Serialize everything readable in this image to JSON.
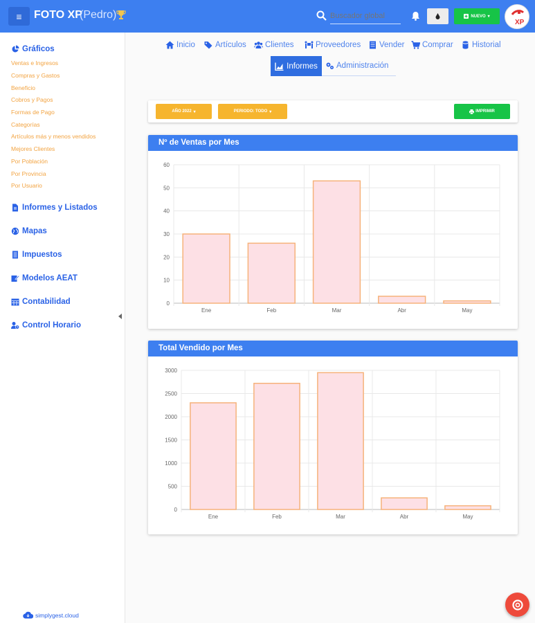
{
  "header": {
    "menu_icon": "hamburger-icon",
    "title": "FOTO XP",
    "user": "(Pedro)",
    "search_placeholder": "Buscador global",
    "new_button": "NUEVO",
    "colors": {
      "primary": "#3d7ff0",
      "success": "#17c447",
      "warning": "#f6b52e"
    }
  },
  "sidebar": {
    "sections": [
      {
        "label": "Gráficos",
        "icon": "pie-chart-icon"
      },
      {
        "label": "Informes y Listados",
        "icon": "file-icon"
      },
      {
        "label": "Mapas",
        "icon": "globe-icon"
      },
      {
        "label": "Impuestos",
        "icon": "document-icon"
      },
      {
        "label": "Modelos AEAT",
        "icon": "edit-icon"
      },
      {
        "label": "Contabilidad",
        "icon": "calendar-icon"
      },
      {
        "label": "Control Horario",
        "icon": "user-clock-icon"
      }
    ],
    "graficos_items": [
      "Ventas e Ingresos",
      "Compras y Gastos",
      "Beneficio",
      "Cobros y Pagos",
      "Formas de Pago",
      "Categorías",
      "Artículos más y menos vendidos",
      "Mejores Clientes",
      "Por Población",
      "Por Provincia",
      "Por Usuario"
    ],
    "footer": "simplygest.cloud"
  },
  "nav": {
    "tabs": [
      "Inicio",
      "Artículos",
      "Clientes",
      "Proveedores",
      "Vender",
      "Comprar",
      "Historial"
    ],
    "active": "Informes",
    "admin": "Administración"
  },
  "filters": {
    "year": "AÑO 2022",
    "period": "PERIODO: TODO",
    "print": "IMPRIMIR"
  },
  "chart_data": [
    {
      "type": "bar",
      "title": "Nº de Ventas por Mes",
      "categories": [
        "Ene",
        "Feb",
        "Mar",
        "Abr",
        "May"
      ],
      "values": [
        30,
        26,
        53,
        3,
        1
      ],
      "ylim": [
        0,
        60
      ],
      "yticks": [
        0,
        10,
        20,
        30,
        40,
        50,
        60
      ],
      "grid": true,
      "colors": {
        "fill": "#fde0e5",
        "stroke": "#f6b27a"
      }
    },
    {
      "type": "bar",
      "title": "Total Vendido por Mes",
      "categories": [
        "Ene",
        "Feb",
        "Mar",
        "Abr",
        "May"
      ],
      "values": [
        2300,
        2720,
        2950,
        250,
        80
      ],
      "ylim": [
        0,
        3000
      ],
      "yticks": [
        0,
        500,
        1000,
        1500,
        2000,
        2500,
        3000
      ],
      "grid": true,
      "colors": {
        "fill": "#fde0e5",
        "stroke": "#f6b27a"
      }
    }
  ]
}
